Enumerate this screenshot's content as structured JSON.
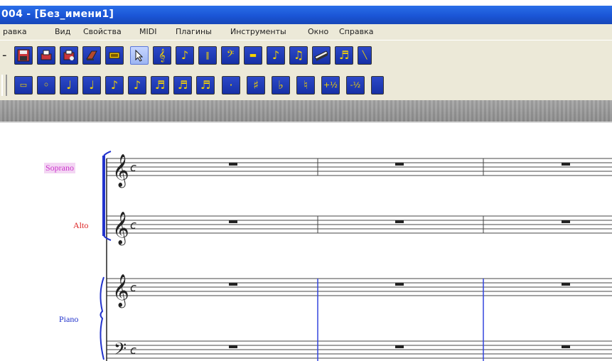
{
  "window": {
    "title": "004 - [Без_имени1]"
  },
  "menu": {
    "items": [
      "равка",
      "Вид",
      "Свойства",
      "MIDI",
      "Плагины",
      "Инструменты",
      "Окно",
      "Справка"
    ]
  },
  "toolbar_top": {
    "buttons": [
      {
        "name": "save-icon"
      },
      {
        "name": "print-icon"
      },
      {
        "name": "print-preview-icon"
      },
      {
        "name": "book-icon"
      },
      {
        "name": "keyboard-icon"
      },
      {
        "name": "select-arrow-icon",
        "selected": true
      },
      {
        "name": "staff-icon"
      },
      {
        "name": "note-insert-icon"
      },
      {
        "name": "measure-icon"
      },
      {
        "name": "bass-clef-icon"
      },
      {
        "name": "text-block-icon"
      },
      {
        "name": "eighth-note-icon"
      },
      {
        "name": "beamed-notes-icon"
      },
      {
        "name": "piano-keyboard-icon"
      },
      {
        "name": "chord-icon"
      }
    ]
  },
  "toolbar_notes": {
    "buttons": [
      {
        "name": "double-whole-note-icon",
        "glyph": "▭"
      },
      {
        "name": "whole-note-icon",
        "glyph": "◦"
      },
      {
        "name": "half-note-icon",
        "glyph": "♩"
      },
      {
        "name": "quarter-note-icon",
        "glyph": "♩"
      },
      {
        "name": "eighth-note-icon",
        "glyph": "♪"
      },
      {
        "name": "sixteenth-note-icon",
        "glyph": "♪"
      },
      {
        "name": "thirty-second-note-icon",
        "glyph": "♬"
      },
      {
        "name": "sixty-fourth-note-icon",
        "glyph": "♬"
      },
      {
        "name": "hundred-twenty-eighth-note-icon",
        "glyph": "♬"
      },
      {
        "name": "dot-icon",
        "glyph": "·"
      },
      {
        "name": "sharp-icon",
        "glyph": "♯"
      },
      {
        "name": "flat-icon",
        "glyph": "♭"
      },
      {
        "name": "natural-icon",
        "glyph": "♮"
      },
      {
        "name": "half-step-up-icon",
        "glyph": "+½"
      },
      {
        "name": "half-step-down-icon",
        "glyph": "-½"
      }
    ]
  },
  "score": {
    "staves": [
      {
        "label": "Soprano",
        "color": "#cc33cc",
        "clef": "treble",
        "time": "c"
      },
      {
        "label": "Alto",
        "color": "#dd2222",
        "clef": "treble",
        "time": "c"
      },
      {
        "label": "Piano",
        "color": "#2233cc",
        "clef": "treble+bass",
        "time": "c"
      }
    ],
    "bracket_color": "#2233cc",
    "barline_color": "#3344dd"
  }
}
